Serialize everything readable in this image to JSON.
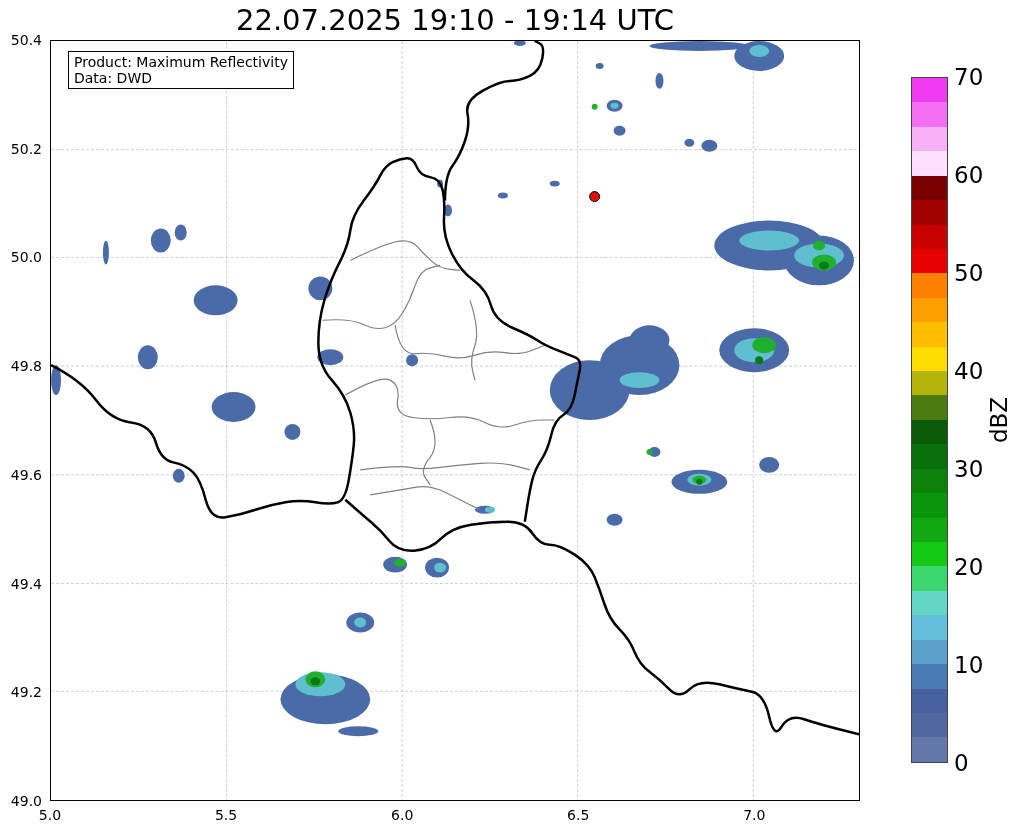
{
  "title": "22.07.2025 19:10 - 19:14 UTC",
  "info": [
    "Product: Maximum Reflectivity",
    "Data: DWD"
  ],
  "map": {
    "yticks": [
      "50.4",
      "50.2",
      "50.0",
      "49.8",
      "49.6",
      "49.4",
      "49.2",
      "49.0"
    ],
    "xticks": [
      "5.0",
      "5.5",
      "6.0",
      "6.5",
      "7.0"
    ]
  },
  "colorbar": {
    "label": "dBZ",
    "ticks": [
      "70",
      "60",
      "50",
      "40",
      "30",
      "20",
      "10",
      "0"
    ],
    "segments": [
      {
        "color": "#f03cf0"
      },
      {
        "color": "#f46ef4"
      },
      {
        "color": "#f8b0f8"
      },
      {
        "color": "#fce0fc"
      },
      {
        "color": "#780000"
      },
      {
        "color": "#a00000"
      },
      {
        "color": "#c80000"
      },
      {
        "color": "#e60000"
      },
      {
        "color": "#ff8000"
      },
      {
        "color": "#ffa000"
      },
      {
        "color": "#ffbe00"
      },
      {
        "color": "#ffdc00"
      },
      {
        "color": "#b4b40a"
      },
      {
        "color": "#4a7a10"
      },
      {
        "color": "#0a5a0a"
      },
      {
        "color": "#0a6e0a"
      },
      {
        "color": "#0a820a"
      },
      {
        "color": "#0a960a"
      },
      {
        "color": "#12a812"
      },
      {
        "color": "#14c814"
      },
      {
        "color": "#3cd66e"
      },
      {
        "color": "#64d6c8"
      },
      {
        "color": "#64bedc"
      },
      {
        "color": "#5aa0c8"
      },
      {
        "color": "#4a7ab4"
      },
      {
        "color": "#4660a0"
      },
      {
        "color": "#50689e"
      },
      {
        "color": "#6478a8"
      }
    ]
  }
}
